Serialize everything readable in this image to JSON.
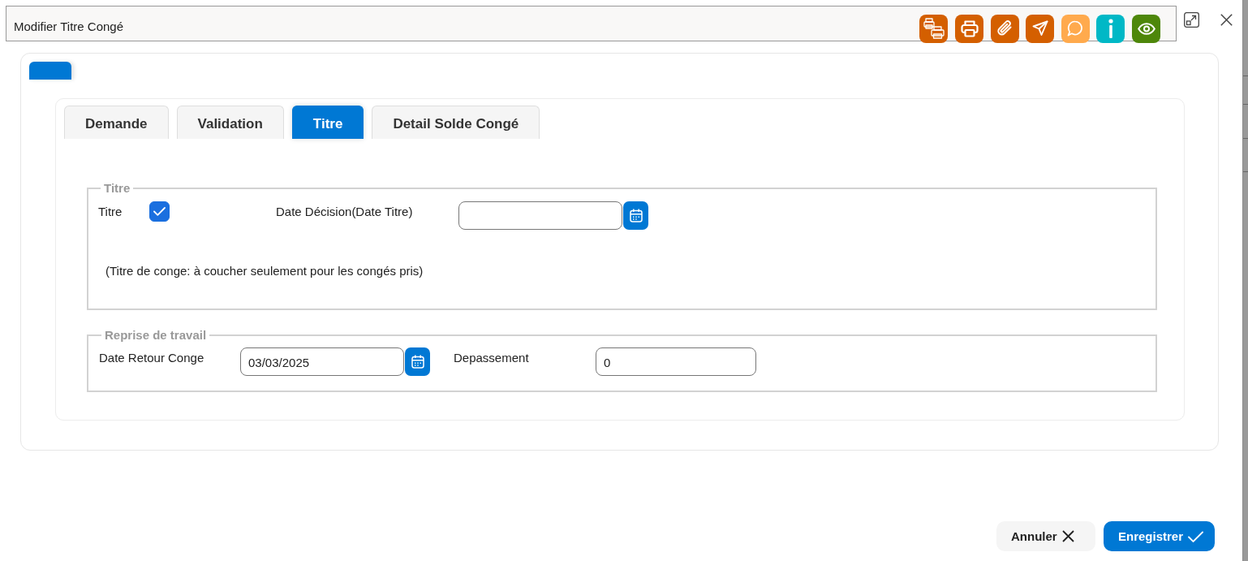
{
  "window": {
    "title": "Modifier Titre Congé"
  },
  "toolbar": [
    {
      "kind": "print-multiple",
      "color": "#d45f00"
    },
    {
      "kind": "print",
      "color": "#d45f00"
    },
    {
      "kind": "attach",
      "color": "#d45f00"
    },
    {
      "kind": "send",
      "color": "#d45f00"
    },
    {
      "kind": "comment",
      "color": "#ffaa4d"
    },
    {
      "kind": "info",
      "color": "#00b8c6"
    },
    {
      "kind": "view",
      "color": "#4e870a"
    }
  ],
  "outer_tabs": [
    {
      "selected": true
    }
  ],
  "tabs": [
    {
      "label": "Demande",
      "selected": false
    },
    {
      "label": "Validation",
      "selected": false
    },
    {
      "label": "Titre",
      "selected": true
    },
    {
      "label": "Detail Solde Congé",
      "selected": false
    }
  ],
  "sections": [
    {
      "legend": "Titre",
      "fields": [
        {
          "kind": "checkbox",
          "label": "Titre",
          "checked": true
        },
        {
          "kind": "date",
          "label": "Date Décision(Date Titre)"
        }
      ],
      "note": "(Titre de conge: à coucher seulement pour les congés pris)"
    },
    {
      "legend": "Reprise de travail",
      "fields": [
        {
          "kind": "date",
          "label": "Date Retour Conge",
          "value": "03/03/2025"
        },
        {
          "kind": "text",
          "label": "Depassement",
          "value": "0"
        }
      ]
    }
  ],
  "buttons": [
    {
      "kind": "cancel",
      "label": "Annuler"
    },
    {
      "kind": "save",
      "label": "Enregistrer"
    }
  ]
}
